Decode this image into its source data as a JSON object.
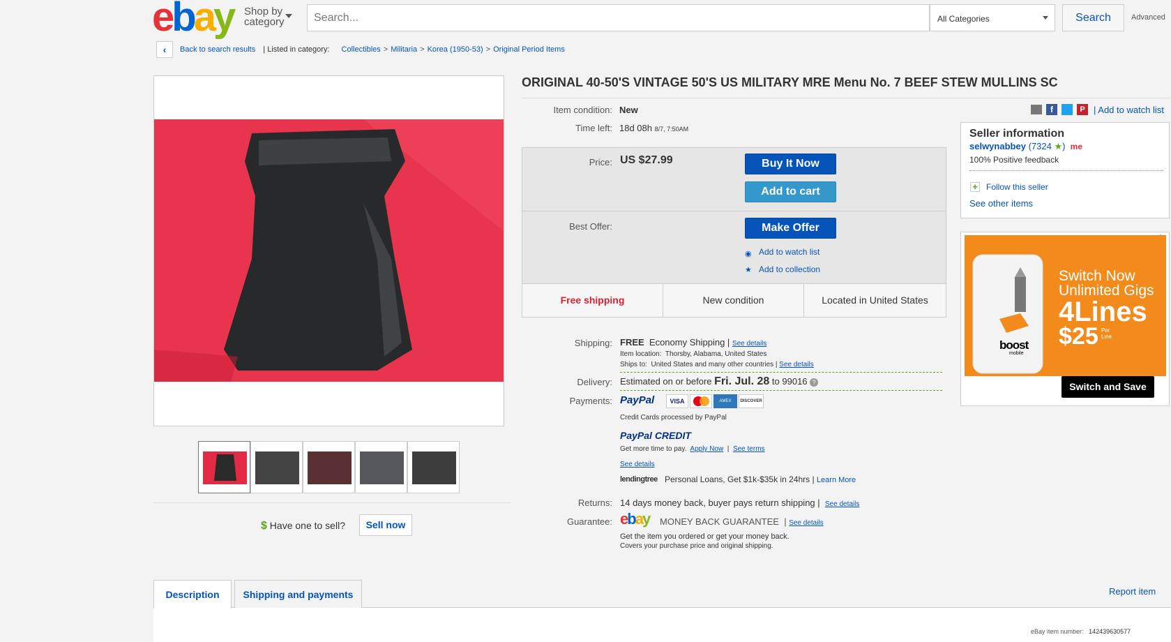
{
  "header": {
    "logo": [
      "e",
      "b",
      "a",
      "y"
    ],
    "shop_by_category": [
      "Shop by",
      "category"
    ],
    "search_placeholder": "Search...",
    "category_select": "All Categories",
    "search_button": "Search",
    "advanced_link": "Advanced"
  },
  "breadcrumb": {
    "back": "Back to search results",
    "listed_in": "| Listed in category:",
    "items": [
      "Collectibles",
      "Militaria",
      "Korea (1950-53)",
      "Original Period Items"
    ],
    "separator": ">"
  },
  "item": {
    "title": "ORIGINAL 40-50'S VINTAGE 50'S US MILITARY MRE Menu No. 7 BEEF STEW MULLINS SC",
    "condition_label": "Item condition:",
    "condition_value": "New",
    "time_left_label": "Time left:",
    "time_left_value": "18d 08h",
    "time_left_end": "8/7, 7:50AM",
    "price_label": "Price:",
    "price_value": "US $27.99",
    "buy_it_now": "Buy It Now",
    "add_to_cart": "Add to cart",
    "best_offer_label": "Best Offer:",
    "make_offer": "Make Offer",
    "add_to_watch_list": "Add to watch list",
    "add_to_collection": "Add to collection",
    "highlights": [
      "Free shipping",
      "New condition",
      "Located in United States"
    ],
    "shipping_label": "Shipping:",
    "shipping_free": "FREE",
    "shipping_method": "Economy Shipping |",
    "see_details": "See details",
    "item_location_label": "Item location:",
    "item_location": "Thorsby, Alabama, United States",
    "ships_to_label": "Ships to:",
    "ships_to": "United States and many other countries |",
    "delivery_label": "Delivery:",
    "delivery_prefix": "Estimated on or before",
    "delivery_date": "Fri. Jul. 28",
    "delivery_zip": "to 99016",
    "payments_label": "Payments:",
    "paypal": "PayPal",
    "cards": [
      "VISA",
      "MC",
      "AMEX",
      "DISCOVER"
    ],
    "credit_cards_note": "Credit Cards processed by PayPal",
    "paypal_credit": "PayPal CREDIT",
    "more_time": "Get more time to pay.",
    "apply_now": "Apply Now",
    "see_terms": "See terms",
    "lendingtree": "lendingtree",
    "loans": "Personal Loans, Get $1k-$35k in 24hrs |",
    "learn_more": "Learn More",
    "returns_label": "Returns:",
    "returns_value": "14 days money back, buyer pays return shipping |",
    "guarantee_label": "Guarantee:",
    "guarantee_text": "MONEY BACK GUARANTEE",
    "guarantee_line1": "Get the item you ordered or get your money back.",
    "guarantee_line2": "Covers your purchase price and original shipping."
  },
  "social": {
    "add_to_watch_list": "| Add to watch list"
  },
  "seller": {
    "heading": "Seller information",
    "name": "selwynabbey",
    "feedback_count": "(7324",
    "feedback_close": ")",
    "me": "me",
    "positive": "100% Positive feedback",
    "follow": "Follow this seller",
    "other_items": "See other items"
  },
  "ad": {
    "line1": "Switch Now",
    "line2": "Unlimited Gigs",
    "line3": "4Lines",
    "price": "$25",
    "per_line": "Per Line",
    "cta": "Switch and Save",
    "brand": "boost",
    "brand_sub": "mobile"
  },
  "sell": {
    "have_one": "Have one to sell?",
    "sell_now": "Sell now",
    "dollar": "$"
  },
  "tabs": [
    "Description",
    "Shipping and payments"
  ],
  "report_item": "Report item",
  "item_number_label": "eBay item number:",
  "item_number": "142439630577",
  "colors": {
    "ebay_red": "#e53238",
    "ebay_blue": "#0064d2",
    "ebay_yellow": "#f5af02",
    "ebay_green": "#86b817",
    "link": "#0654ba",
    "free_shipping": "#dd1e31",
    "photo_background": "#e22a44",
    "ad_orange": "#f38b1c"
  }
}
